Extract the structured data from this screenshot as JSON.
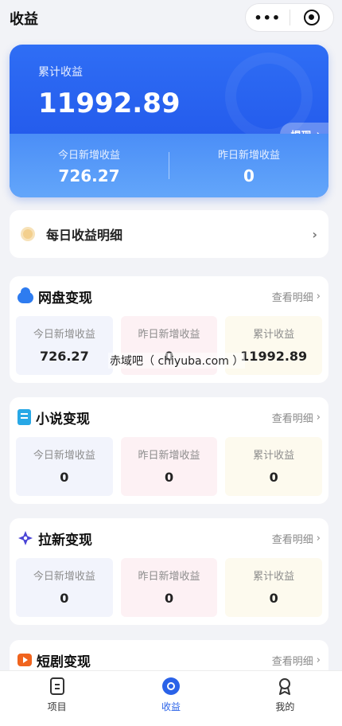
{
  "header": {
    "title": "收益",
    "more_icon": "more-dots-icon",
    "close_icon": "target-icon"
  },
  "hero": {
    "total_label": "累计收益",
    "total_value": "11992.89",
    "withdraw_label": "提现",
    "today_label": "今日新增收益",
    "today_value": "726.27",
    "yesterday_label": "昨日新增收益",
    "yesterday_value": "0",
    "color": "#1d4fe6"
  },
  "daily": {
    "label": "每日收益明细"
  },
  "cards": [
    {
      "title": "网盘变现",
      "more": "查看明细",
      "icon": "cloud-icon",
      "cells": [
        {
          "label": "今日新增收益",
          "value": "726.27"
        },
        {
          "label": "昨日新增收益",
          "value": "0"
        },
        {
          "label": "累计收益",
          "value": "11992.89"
        }
      ]
    },
    {
      "title": "小说变现",
      "more": "查看明细",
      "icon": "book-icon",
      "cells": [
        {
          "label": "今日新增收益",
          "value": "0"
        },
        {
          "label": "昨日新增收益",
          "value": "0"
        },
        {
          "label": "累计收益",
          "value": "0"
        }
      ]
    },
    {
      "title": "拉新变现",
      "more": "查看明细",
      "icon": "sparkle-icon",
      "cells": [
        {
          "label": "今日新增收益",
          "value": "0"
        },
        {
          "label": "昨日新增收益",
          "value": "0"
        },
        {
          "label": "累计收益",
          "value": "0"
        }
      ]
    },
    {
      "title": "短剧变现",
      "more": "查看明细",
      "icon": "play-icon"
    }
  ],
  "watermark": "赤域吧（ chiyuba.com ）",
  "tabbar": {
    "items": [
      {
        "label": "项目",
        "icon": "document-icon"
      },
      {
        "label": "收益",
        "icon": "coin-icon"
      },
      {
        "label": "我的",
        "icon": "medal-icon"
      }
    ],
    "active_color": "#2a62e8"
  }
}
